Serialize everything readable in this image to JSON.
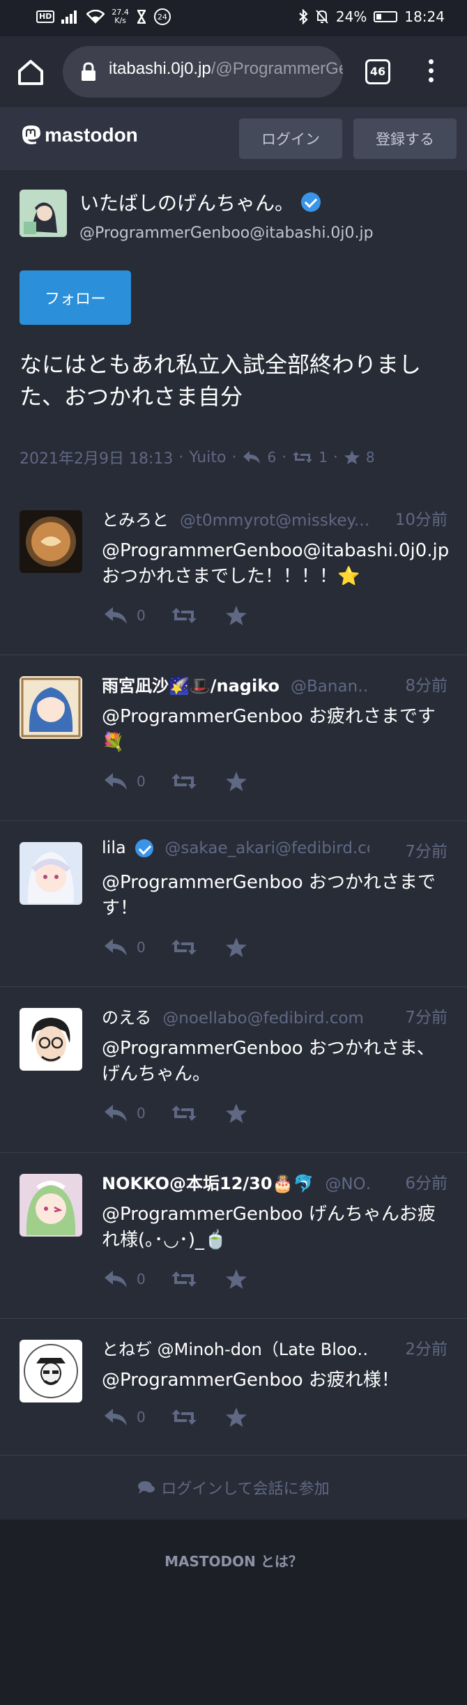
{
  "statusbar": {
    "hd": "HD",
    "speed_value": "27.4",
    "speed_unit": "K/s",
    "alarm_badge": "24",
    "battery": "24%",
    "time": "18:24"
  },
  "browser": {
    "url_host": "itabashi.0j0.jp",
    "url_path": "/@ProgrammerGenboo",
    "tab_count": "46"
  },
  "header": {
    "logo": "mastodon",
    "login_label": "ログイン",
    "register_label": "登録する"
  },
  "detail": {
    "display_name": "いたばしのげんちゃん。",
    "acct": "@ProgrammerGenboo@itabashi.0j0.jp",
    "follow_label": "フォロー",
    "content": "なにはともあれ私立入試全部終わりました、おつかれさま自分",
    "date": "2021年2月9日 18:13",
    "app": "Yuito",
    "replies": "6",
    "boosts": "1",
    "favourites": "8"
  },
  "replies": [
    {
      "name": "とみろと",
      "acct": "@t0mmyrot@misskey.…",
      "time": "10分前",
      "content": "@ProgrammerGenboo@itabashi.0j0.jp おつかれさまでした！！！！⭐",
      "reply_count": "0"
    },
    {
      "name": "雨宮凪沙🌠🎩/nagiko",
      "acct": "@Banan…",
      "time": "8分前",
      "content": "@ProgrammerGenboo お疲れさまです💐",
      "reply_count": "0"
    },
    {
      "name": "lila",
      "acct": "@sakae_akari@fedibird.co…",
      "time": "7分前",
      "content": "@ProgrammerGenboo おつかれさまです！",
      "reply_count": "0"
    },
    {
      "name": "のえる",
      "acct": "@noellabo@fedibird.com",
      "time": "7分前",
      "content": "@ProgrammerGenboo おつかれさま、げんちゃん。",
      "reply_count": "0"
    },
    {
      "name": "NOKKO@本垢12/30🎂🐬",
      "acct": "@NO…",
      "time": "6分前",
      "content": "@ProgrammerGenboo げんちゃんお疲れ様(｡･◡･)_🍵",
      "reply_count": "0"
    },
    {
      "name": "とねぢ @Minoh-don（Late Bloo…",
      "acct": "",
      "time": "2分前",
      "content": "@ProgrammerGenboo お疲れ様！",
      "reply_count": "0"
    }
  ],
  "login_join": "ログインして会話に参加",
  "footer": {
    "about_label": "MASTODON とは？"
  },
  "colors": {
    "accent": "#2b90d9",
    "background": "#191b22",
    "card": "#282c37",
    "muted": "#606984"
  }
}
